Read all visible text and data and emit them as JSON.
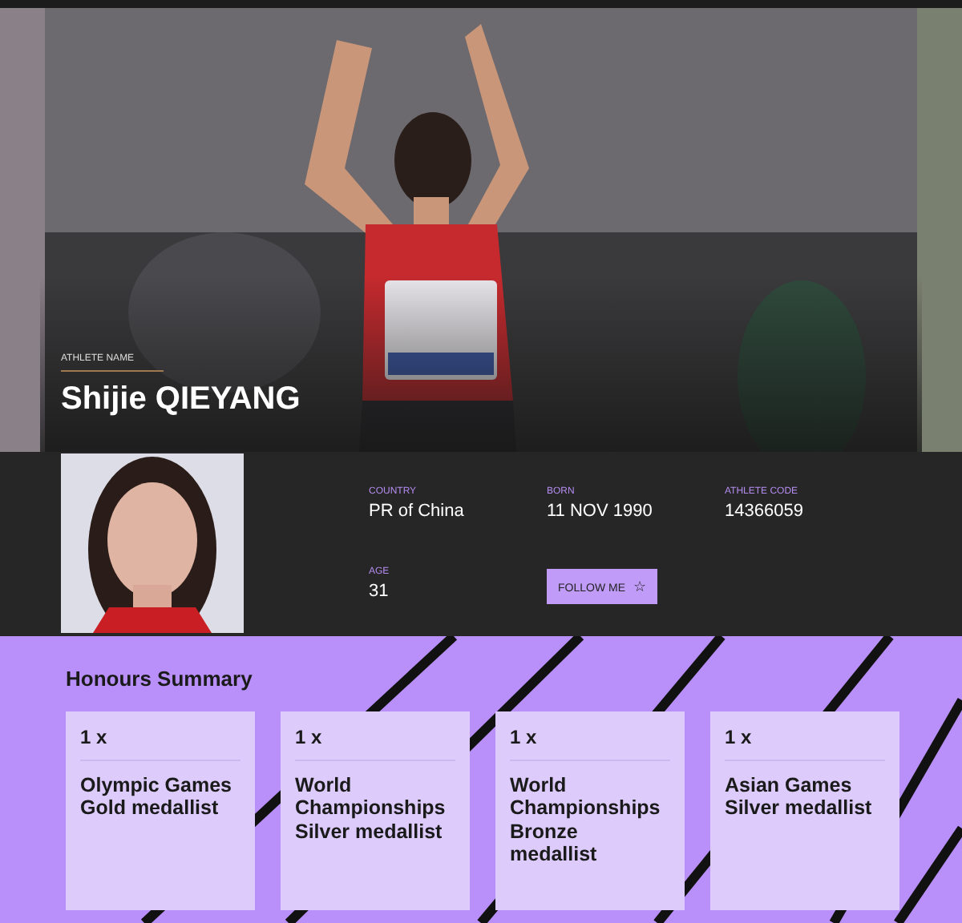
{
  "hero": {
    "kind": "picture",
    "label": "ATHLETE NAME",
    "name": "Shijie QIEYANG"
  },
  "profile": {
    "facts": [
      {
        "label": "COUNTRY",
        "value": "PR of China"
      },
      {
        "label": "BORN",
        "value": "11 NOV 1990"
      },
      {
        "label": "ATHLETE CODE",
        "value": "14366059"
      },
      {
        "label": "AGE",
        "value": "31"
      }
    ],
    "follow_button": {
      "label": "FOLLOW ME",
      "icon": "☆"
    }
  },
  "honours": {
    "title": "Honours Summary",
    "cards": [
      {
        "count": "1 x",
        "title": "Olympic Games Gold medallist"
      },
      {
        "count": "1 x",
        "title": "World Championships Silver medallist"
      },
      {
        "count": "1 x",
        "title": "World Championships Bronze medallist"
      },
      {
        "count": "1 x",
        "title": "Asian Games Silver medallist"
      }
    ]
  }
}
